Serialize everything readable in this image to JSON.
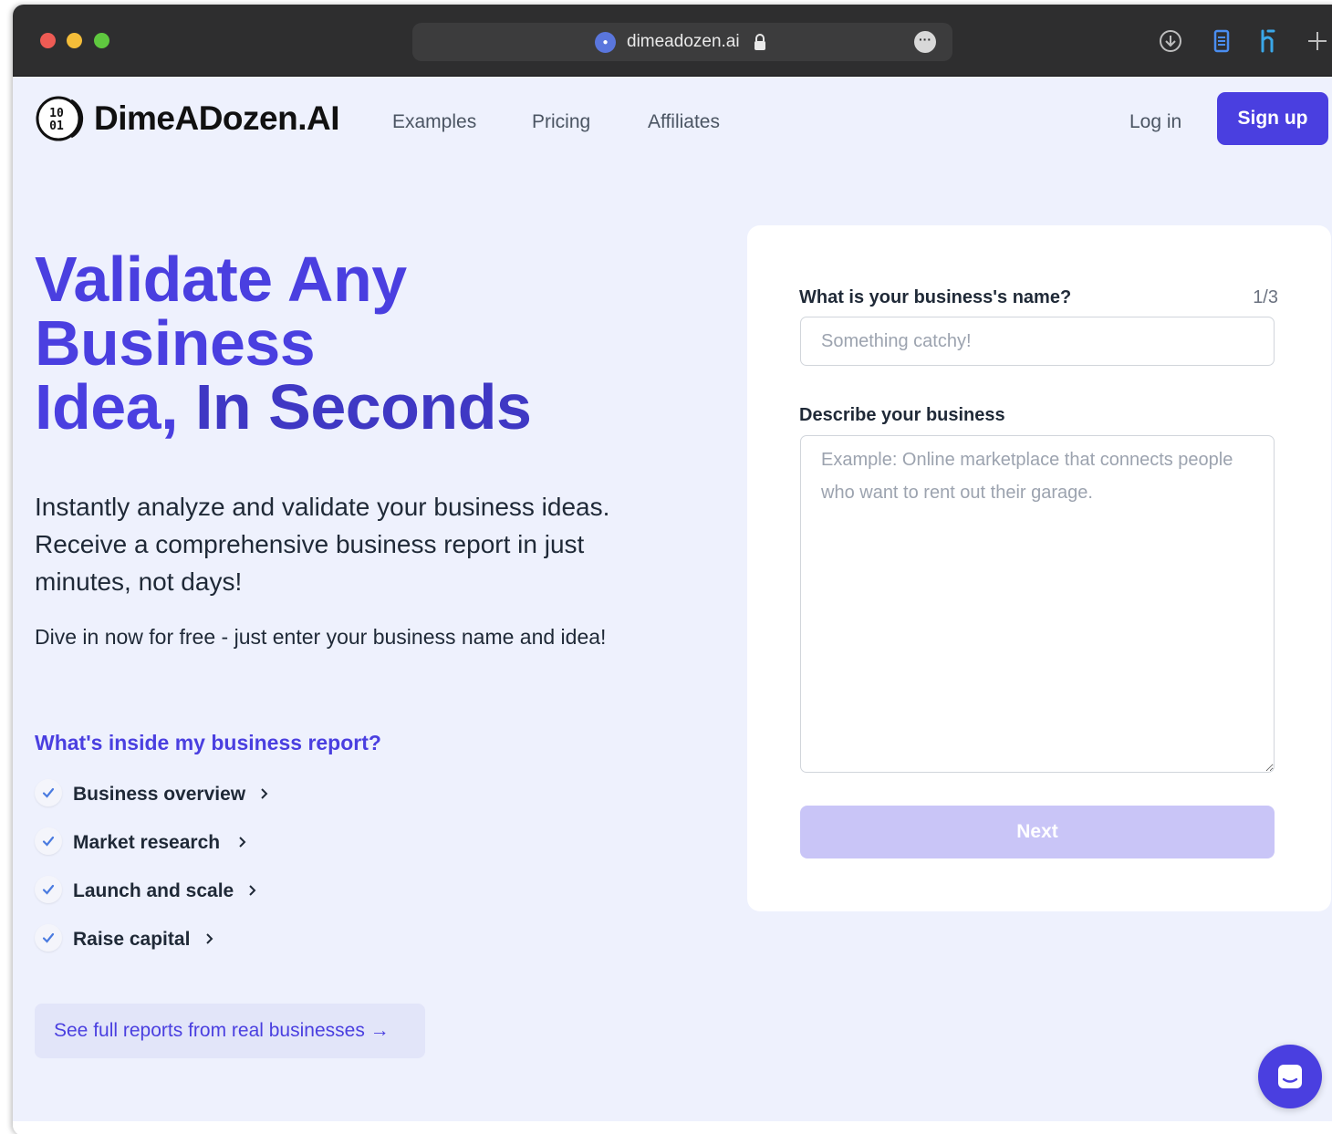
{
  "browser": {
    "url": "dimeadozen.ai",
    "site_icon": "site-favicon"
  },
  "nav": {
    "brand": "DimeADozen.AI",
    "logo_glyph_top": "10",
    "logo_glyph_bottom": "01",
    "links": [
      "Examples",
      "Pricing",
      "Affiliates"
    ],
    "login": "Log in",
    "signup": "Sign up"
  },
  "hero": {
    "title_line1": "Validate Any",
    "title_line2": "Business",
    "title_line3a": "Idea, ",
    "title_line3b": "In Seconds",
    "subtitle": "Instantly analyze and validate your business ideas. Receive a comprehensive business report in just minutes, not days!",
    "cta_text": "Dive in now for free - just enter your business name and idea!",
    "inside_heading": "What's inside my business report?",
    "features": [
      "Business overview",
      "Market research",
      "Launch and scale",
      "Raise capital"
    ],
    "reports_link": "See full reports from real businesses →"
  },
  "form": {
    "name_label": "What is your business's name?",
    "step": "1/3",
    "name_placeholder": "Something catchy!",
    "desc_label": "Describe your business",
    "desc_placeholder": "Example: Online marketplace that connects people who want to rent out their garage.",
    "next": "Next"
  },
  "colors": {
    "brand": "#4a3fe0",
    "background": "#eef1fd",
    "next_disabled": "#c9c5f7"
  }
}
